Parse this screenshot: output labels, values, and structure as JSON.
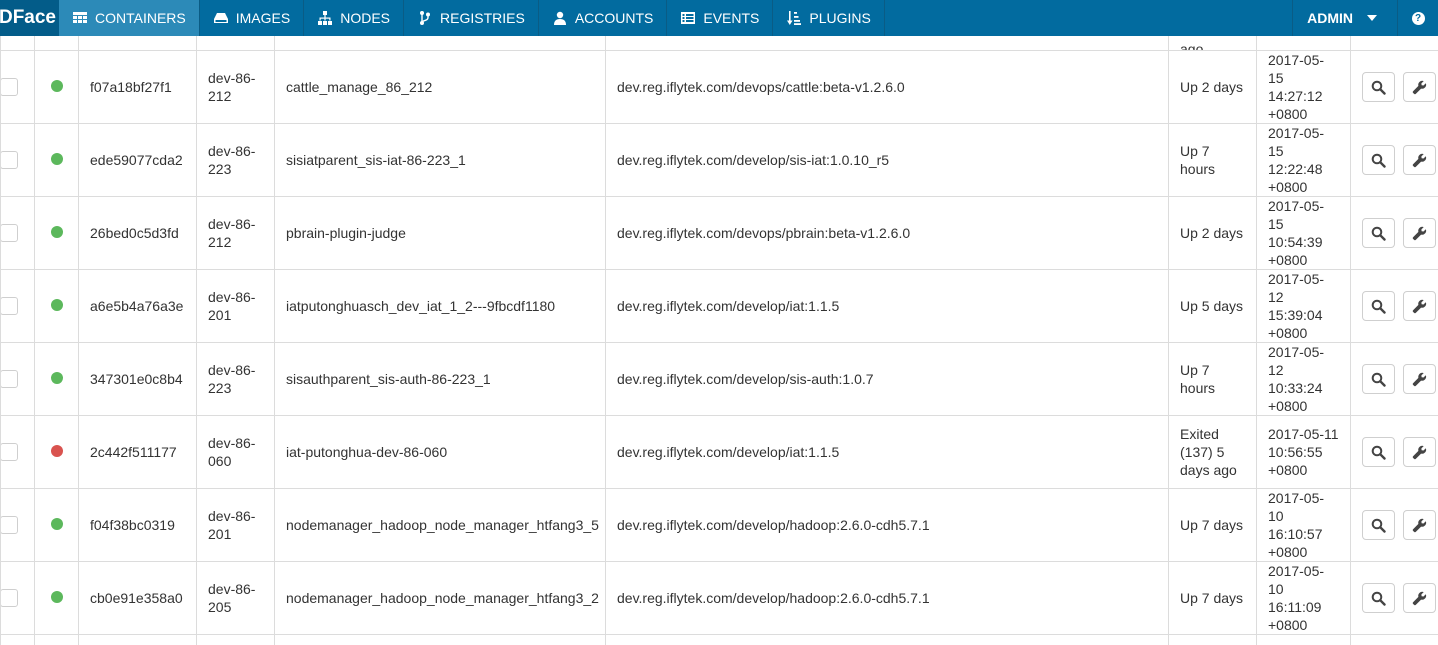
{
  "brand": "DFace",
  "nav": {
    "items": [
      {
        "label": "CONTAINERS",
        "icon": "table-icon",
        "active": true
      },
      {
        "label": "IMAGES",
        "icon": "drive-icon",
        "active": false
      },
      {
        "label": "NODES",
        "icon": "sitemap-icon",
        "active": false
      },
      {
        "label": "REGISTRIES",
        "icon": "branch-icon",
        "active": false
      },
      {
        "label": "ACCOUNTS",
        "icon": "user-icon",
        "active": false
      },
      {
        "label": "EVENTS",
        "icon": "list-icon",
        "active": false
      },
      {
        "label": "PLUGINS",
        "icon": "sort-icon",
        "active": false
      }
    ],
    "user": "ADMIN",
    "help": "?"
  },
  "colors": {
    "navbar": "#026b9f",
    "nav_active": "#2c8ab8",
    "running": "#5cb85c",
    "exited": "#d9534f"
  },
  "containers": {
    "top_partial_status": "ago",
    "rows": [
      {
        "id": "f07a18bf27f1",
        "node": "dev-86-212",
        "name": "cattle_manage_86_212",
        "image": "dev.reg.iflytek.com/devops/cattle:beta-v1.2.6.0",
        "status": "Up 2 days",
        "created": "2017-05-15 14:27:12 +0800",
        "state": "running"
      },
      {
        "id": "ede59077cda2",
        "node": "dev-86-223",
        "name": "sisiatparent_sis-iat-86-223_1",
        "image": "dev.reg.iflytek.com/develop/sis-iat:1.0.10_r5",
        "status": "Up 7 hours",
        "created": "2017-05-15 12:22:48 +0800",
        "state": "running"
      },
      {
        "id": "26bed0c5d3fd",
        "node": "dev-86-212",
        "name": "pbrain-plugin-judge",
        "image": "dev.reg.iflytek.com/devops/pbrain:beta-v1.2.6.0",
        "status": "Up 2 days",
        "created": "2017-05-15 10:54:39 +0800",
        "state": "running"
      },
      {
        "id": "a6e5b4a76a3e",
        "node": "dev-86-201",
        "name": "iatputonghuasch_dev_iat_1_2---9fbcdf1180",
        "image": "dev.reg.iflytek.com/develop/iat:1.1.5",
        "status": "Up 5 days",
        "created": "2017-05-12 15:39:04 +0800",
        "state": "running"
      },
      {
        "id": "347301e0c8b4",
        "node": "dev-86-223",
        "name": "sisauthparent_sis-auth-86-223_1",
        "image": "dev.reg.iflytek.com/develop/sis-auth:1.0.7",
        "status": "Up 7 hours",
        "created": "2017-05-12 10:33:24 +0800",
        "state": "running"
      },
      {
        "id": "2c442f511177",
        "node": "dev-86-060",
        "name": "iat-putonghua-dev-86-060",
        "image": "dev.reg.iflytek.com/develop/iat:1.1.5",
        "status": "Exited (137) 5 days ago",
        "created": "2017-05-11 10:56:55 +0800",
        "state": "exited"
      },
      {
        "id": "f04f38bc0319",
        "node": "dev-86-201",
        "name": "nodemanager_hadoop_node_manager_htfang3_5",
        "image": "dev.reg.iflytek.com/develop/hadoop:2.6.0-cdh5.7.1",
        "status": "Up 7 days",
        "created": "2017-05-10 16:10:57 +0800",
        "state": "running"
      },
      {
        "id": "cb0e91e358a0",
        "node": "dev-86-205",
        "name": "nodemanager_hadoop_node_manager_htfang3_2",
        "image": "dev.reg.iflytek.com/develop/hadoop:2.6.0-cdh5.7.1",
        "status": "Up 7 days",
        "created": "2017-05-10 16:11:09 +0800",
        "state": "running"
      }
    ]
  }
}
